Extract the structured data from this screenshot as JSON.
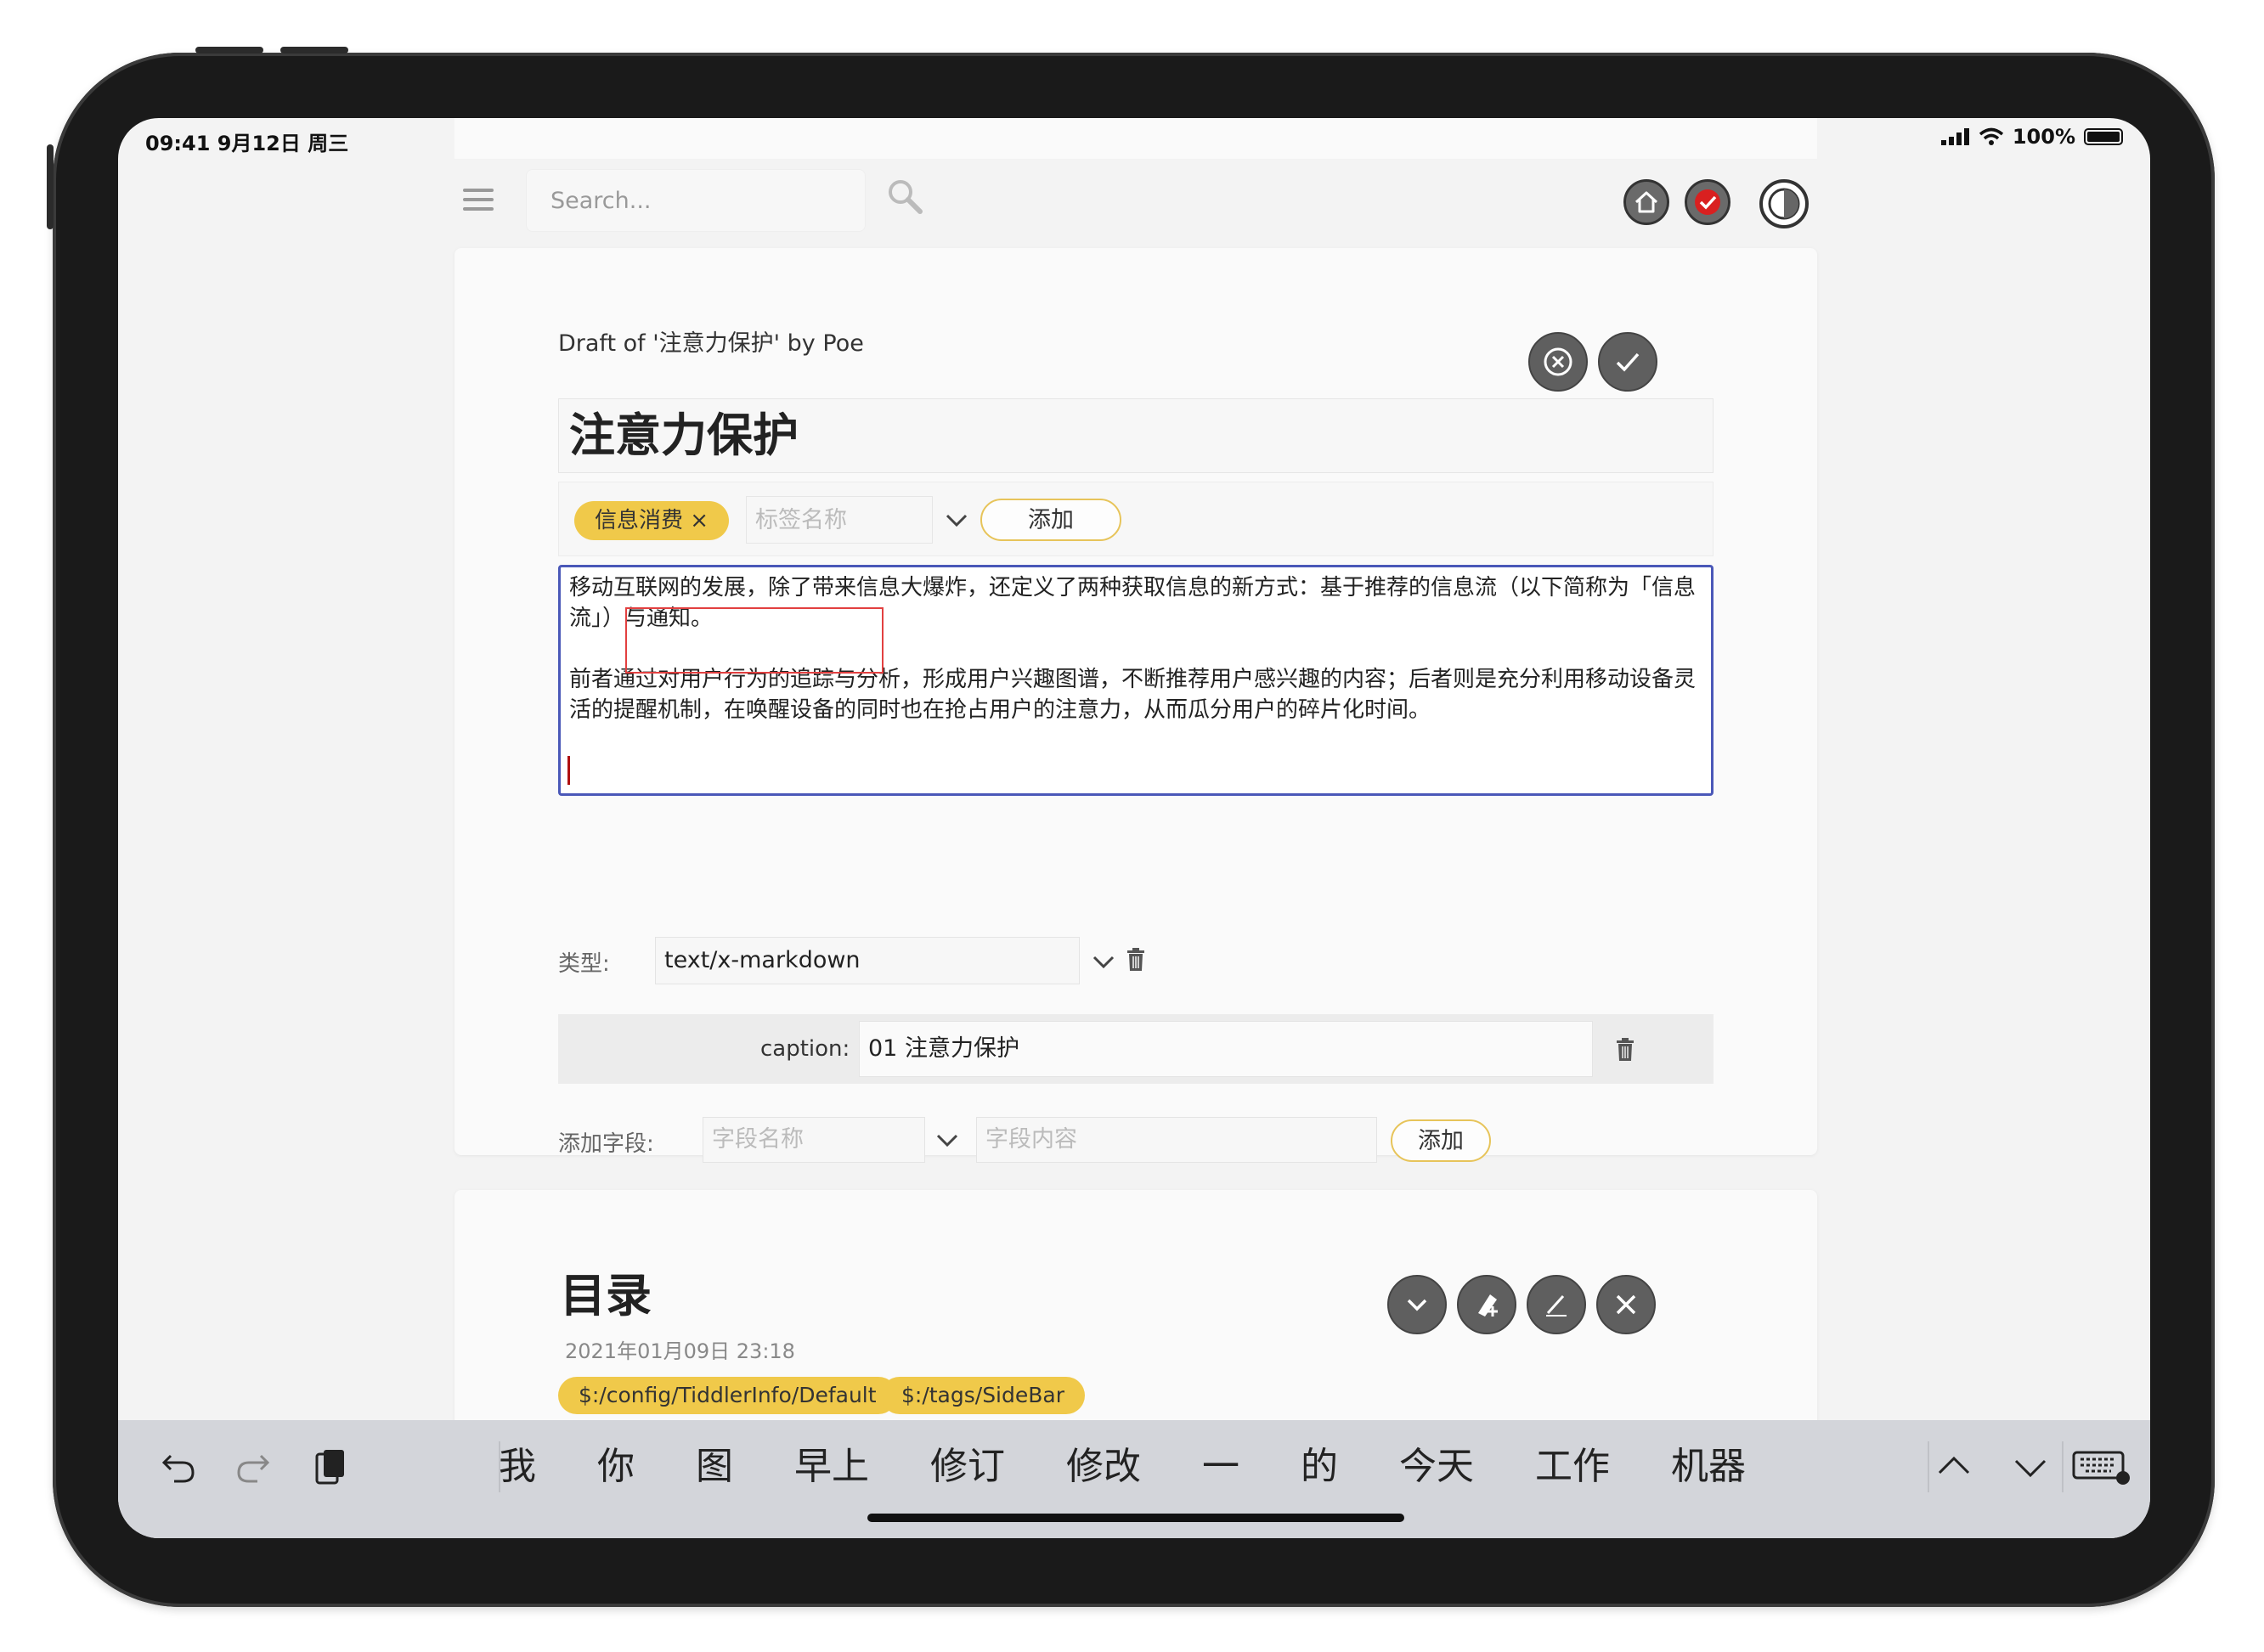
{
  "status_bar": {
    "time": "09:41 9月12日 周三",
    "battery": "100%"
  },
  "toolbar": {
    "search_placeholder": "Search..."
  },
  "editor": {
    "draft_title": "Draft of '注意力保护' by Poe",
    "title_value": "注意力保护",
    "tag": {
      "name": "信息消费",
      "remove": "×",
      "input_placeholder": "标签名称",
      "add_label": "添加"
    },
    "body_paragraphs": [
      "移动互联网的发展，除了带来信息大爆炸，还定义了两种获取信息的新方式：基于推荐的信息流（以下简称为「信息流」）与通知。",
      "前者通过对用户行为的追踪与分析，形成用户兴趣图谱，不断推荐用户感兴趣的内容；后者则是充分利用移动设备灵活的提醒机制，在唤醒设备的同时也在抢占用户的注意力，从而瓜分用户的碎片化时间。"
    ],
    "type_label": "类型:",
    "type_value": "text/x-markdown",
    "caption_label": "caption:",
    "caption_value": "01 注意力保护",
    "add_field_label": "添加字段:",
    "field_name_placeholder": "字段名称",
    "field_value_placeholder": "字段内容",
    "add_field_button": "添加"
  },
  "tiddler2": {
    "title": "目录",
    "date": "2021年01月09日 23:18",
    "tags": [
      "$:/config/TiddlerInfo/Default",
      "$:/tags/SideBar"
    ]
  },
  "keyboard": {
    "candidates": [
      "我",
      "你",
      "图",
      "早上",
      "修订",
      "修改",
      "一",
      "的",
      "今天",
      "工作",
      "机器"
    ]
  },
  "colors": {
    "tag_yellow": "#f0c94a",
    "focus_blue": "#4a58b8",
    "highlight_red": "#e24040",
    "button_gray": "#5f5f5f"
  }
}
